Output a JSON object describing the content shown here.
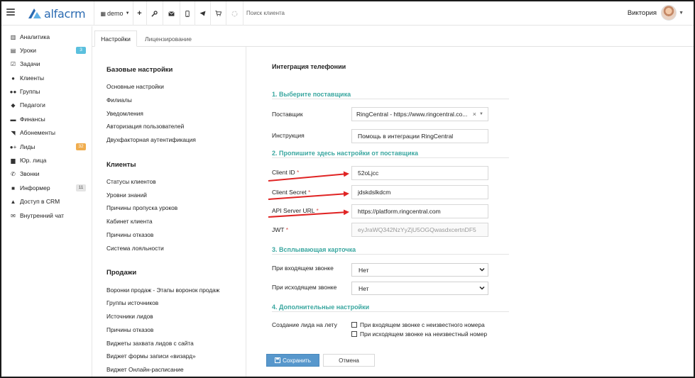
{
  "app": {
    "logo_text": "alfacrm",
    "branch": "demo",
    "search_placeholder": "Поиск клиента",
    "user_name": "Виктория",
    "brand_color": "#2b6bb2"
  },
  "toolbar_icons": [
    "plus-icon",
    "wrench-icon",
    "mail-icon",
    "phone-icon",
    "telegram-icon",
    "cart-icon",
    "spinner-icon"
  ],
  "sidebar": {
    "items": [
      {
        "label": "Аналитика",
        "icon": "chart-icon"
      },
      {
        "label": "Уроки",
        "icon": "calendar-icon",
        "badge": "3",
        "badge_color": "#5bc0de"
      },
      {
        "label": "Задачи",
        "icon": "tasks-icon"
      },
      {
        "label": "Клиенты",
        "icon": "user-icon"
      },
      {
        "label": "Группы",
        "icon": "users-icon"
      },
      {
        "label": "Педагоги",
        "icon": "graduation-icon"
      },
      {
        "label": "Финансы",
        "icon": "money-icon"
      },
      {
        "label": "Абонементы",
        "icon": "tag-icon"
      },
      {
        "label": "Лиды",
        "icon": "user-plus-icon",
        "badge": "32",
        "badge_color": "#f0ad4e"
      },
      {
        "label": "Юр. лица",
        "icon": "building-icon"
      },
      {
        "label": "Звонки",
        "icon": "phone-icon"
      },
      {
        "label": "Информер",
        "icon": "informer-icon",
        "badge": "11",
        "badge_color": "#e4e4e4"
      },
      {
        "label": "Доступ в CRM",
        "icon": "lock-icon"
      },
      {
        "label": "Внутренний чат",
        "icon": "chat-icon"
      }
    ]
  },
  "tabs": [
    {
      "label": "Настройки",
      "active": true
    },
    {
      "label": "Лицензирование",
      "active": false
    }
  ],
  "settings_menu": {
    "sections": [
      {
        "heading": "Базовые настройки",
        "links": [
          "Основные настройки",
          "Филиалы",
          "Уведомления",
          "Авторизация пользователей",
          "Двухфакторная аутентификация"
        ]
      },
      {
        "heading": "Клиенты",
        "links": [
          "Статусы клиентов",
          "Уровни знаний",
          "Причины пропуска уроков",
          "Кабинет клиента",
          "Причины отказов",
          "Система лояльности"
        ]
      },
      {
        "heading": "Продажи",
        "links": [
          "Воронки продаж - Этапы воронок продаж",
          "Группы источников",
          "Источники лидов",
          "Причины отказов",
          "Виджеты захвата лидов с сайта",
          "Виджет формы записи «визард»",
          "Виджет Онлайн-расписание"
        ]
      }
    ]
  },
  "form": {
    "title": "Интеграция телефонии",
    "section_provider": "1. Выберите поставщика",
    "provider_label": "Поставщик",
    "provider_value": "RingCentral - https://www.ringcentral.co...",
    "instruction_label": "Инструкция",
    "instruction_value": "Помощь в интеграции RingCentral",
    "section_settings": "2. Пропишите здесь настройки от поставщика",
    "client_id_label": "Client ID",
    "client_id_value": "52oLjcc",
    "client_secret_label": "Client Secret",
    "client_secret_value": "jdskdslkdcm",
    "api_url_label": "API Server URL",
    "api_url_value": "https://platform.ringcentral.com",
    "jwt_label": "JWT",
    "jwt_value": "eyJraWQ342NzYyZjU5OGQwasdxcertnDF5",
    "required_mark": "*",
    "section_popup": "3. Всплывающая карточка",
    "incoming_label": "При входящем звонке",
    "incoming_value": "Нет",
    "outgoing_label": "При исходящем звонке",
    "outgoing_value": "Нет",
    "section_extra": "4. Дополнительные настройки",
    "lead_label": "Создание лида на лету",
    "check_incoming": "При входящем звонке с неизвестного номера",
    "check_outgoing": "При исходящем звонке на неизвестный номер",
    "save_label": "Сохранить",
    "cancel_label": "Отмена",
    "section_color": "#3aa7a0",
    "save_color": "#5797cc",
    "annotation_color": "#e02424"
  }
}
